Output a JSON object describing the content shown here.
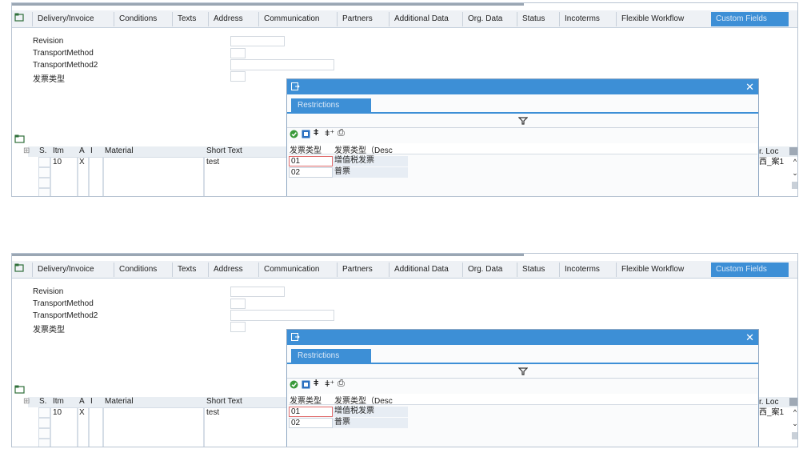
{
  "tabs": [
    {
      "label": "Delivery/Invoice",
      "active": false
    },
    {
      "label": "Conditions",
      "active": false
    },
    {
      "label": "Texts",
      "active": false
    },
    {
      "label": "Address",
      "active": false
    },
    {
      "label": "Communication",
      "active": false
    },
    {
      "label": "Partners",
      "active": false
    },
    {
      "label": "Additional Data",
      "active": false
    },
    {
      "label": "Org. Data",
      "active": false
    },
    {
      "label": "Status",
      "active": false
    },
    {
      "label": "Incoterms",
      "active": false
    },
    {
      "label": "Flexible Workflow",
      "active": false
    },
    {
      "label": "Custom Fields",
      "active": true
    }
  ],
  "fields": [
    {
      "label": "Revision",
      "value": ""
    },
    {
      "label": "TransportMethod",
      "value": ""
    },
    {
      "label": "TransportMethod2",
      "value": ""
    },
    {
      "label": "发票类型",
      "value": ""
    }
  ],
  "items_table": {
    "columns": [
      "S.",
      "Itm",
      "A",
      "I",
      "Material",
      "Short Text"
    ],
    "rows": [
      {
        "itm": "10",
        "a": "X",
        "i": "",
        "material": "",
        "short_text": "test"
      }
    ],
    "right_header": "r. Loc",
    "right_value": "西_案1"
  },
  "popup": {
    "tab_label": "Restrictions",
    "columns": [
      "发票类型",
      "发票类型（Desc"
    ],
    "rows": [
      {
        "code": "01",
        "desc": "增值税发票",
        "selected": true
      },
      {
        "code": "02",
        "desc": "普票",
        "selected": false
      }
    ]
  },
  "colors": {
    "accent": "#3d8fd6",
    "tab_bar": "#eef1f5",
    "header_bg": "#e9eef3"
  },
  "icons": [
    "tab-scroll-icon",
    "table-settings-icon",
    "popup-window-icon",
    "close-icon",
    "filter-funnel-icon",
    "check-icon",
    "stop-icon",
    "binoculars-icon",
    "binoculars-next-icon",
    "print-icon",
    "scroll-up-icon",
    "scroll-down-icon"
  ]
}
